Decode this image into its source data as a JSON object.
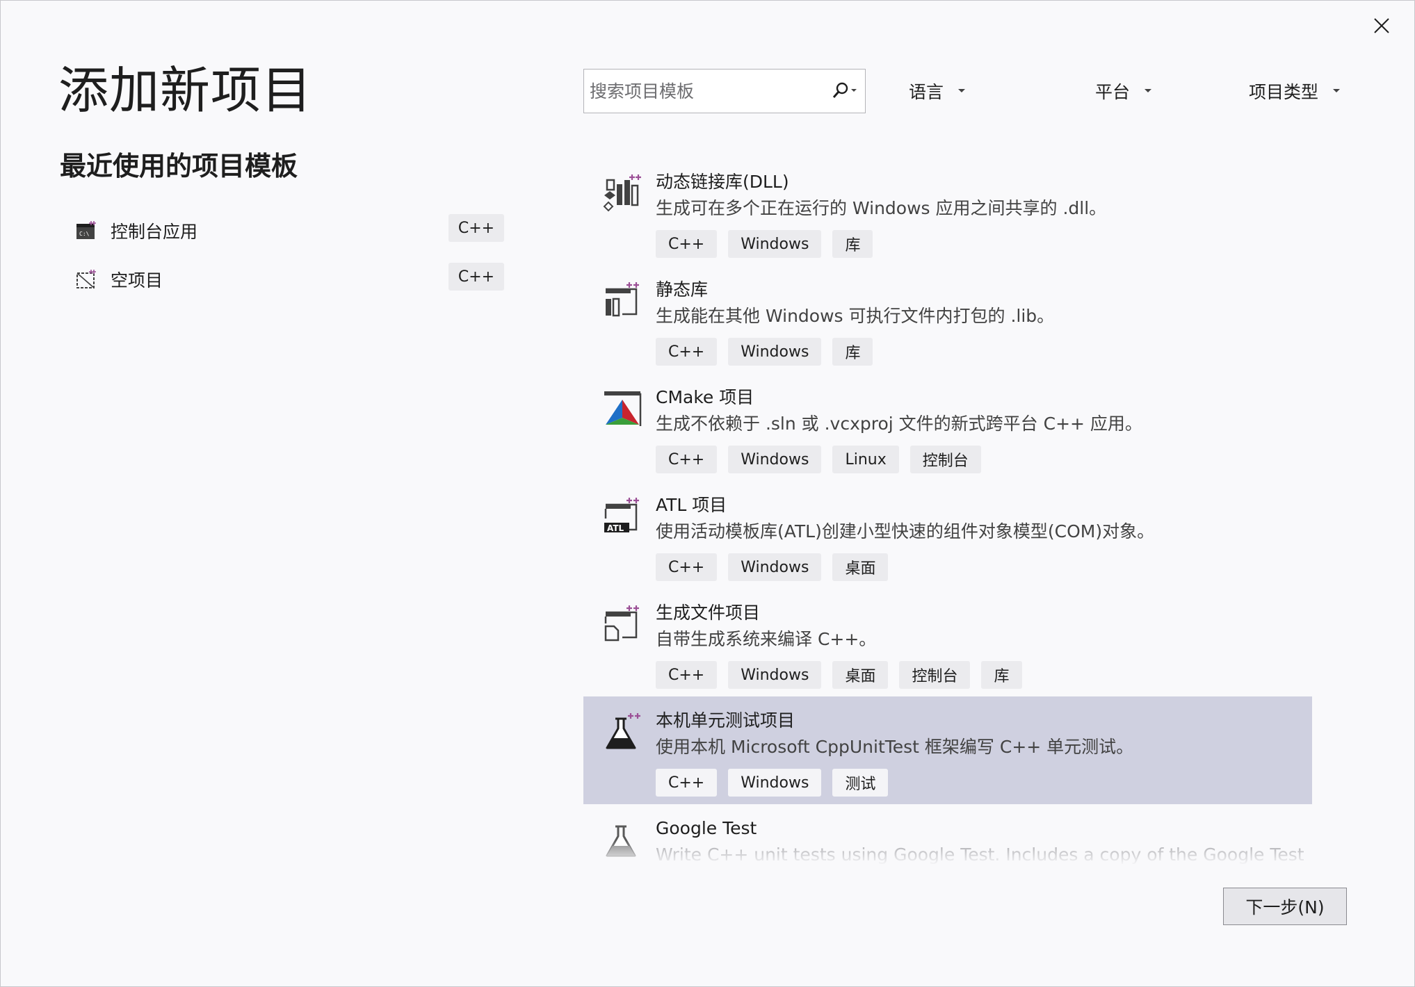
{
  "header": {
    "title": "添加新项目",
    "close_icon": "close-icon"
  },
  "recent": {
    "title": "最近使用的项目模板",
    "items": [
      {
        "label": "控制台应用",
        "tag": "C++",
        "icon": "console-app-icon"
      },
      {
        "label": "空项目",
        "tag": "C++",
        "icon": "empty-project-icon"
      }
    ]
  },
  "search": {
    "placeholder": "搜索项目模板",
    "value": ""
  },
  "filters": {
    "language": "语言",
    "platform": "平台",
    "project_type": "项目类型"
  },
  "templates": [
    {
      "name": "动态链接库(DLL)",
      "desc": "生成可在多个正在运行的 Windows 应用之间共享的 .dll。",
      "tags": [
        "C++",
        "Windows",
        "库"
      ],
      "icon": "dll-icon"
    },
    {
      "name": "静态库",
      "desc": "生成能在其他 Windows 可执行文件内打包的 .lib。",
      "tags": [
        "C++",
        "Windows",
        "库"
      ],
      "icon": "static-lib-icon"
    },
    {
      "name": "CMake 项目",
      "desc": "生成不依赖于 .sln 或 .vcxproj 文件的新式跨平台 C++ 应用。",
      "tags": [
        "C++",
        "Windows",
        "Linux",
        "控制台"
      ],
      "icon": "cmake-icon"
    },
    {
      "name": "ATL 项目",
      "desc": "使用活动模板库(ATL)创建小型快速的组件对象模型(COM)对象。",
      "tags": [
        "C++",
        "Windows",
        "桌面"
      ],
      "icon": "atl-icon"
    },
    {
      "name": "生成文件项目",
      "desc": "自带生成系统来编译 C++。",
      "tags": [
        "C++",
        "Windows",
        "桌面",
        "控制台",
        "库"
      ],
      "icon": "makefile-icon"
    },
    {
      "name": "本机单元测试项目",
      "desc": "使用本机 Microsoft CppUnitTest 框架编写 C++ 单元测试。",
      "tags": [
        "C++",
        "Windows",
        "测试"
      ],
      "icon": "unit-test-icon",
      "selected": true
    },
    {
      "name": "Google Test",
      "desc": "Write C++ unit tests using Google Test. Includes a copy of the Google Test",
      "tags": [],
      "icon": "google-test-icon"
    }
  ],
  "footer": {
    "next_label": "下一步(N)"
  },
  "colors": {
    "background": "#f9f9fb",
    "selected_row": "#cfd0e0",
    "tag_bg": "#ebebee",
    "accent_purple": "#9b4f96"
  }
}
